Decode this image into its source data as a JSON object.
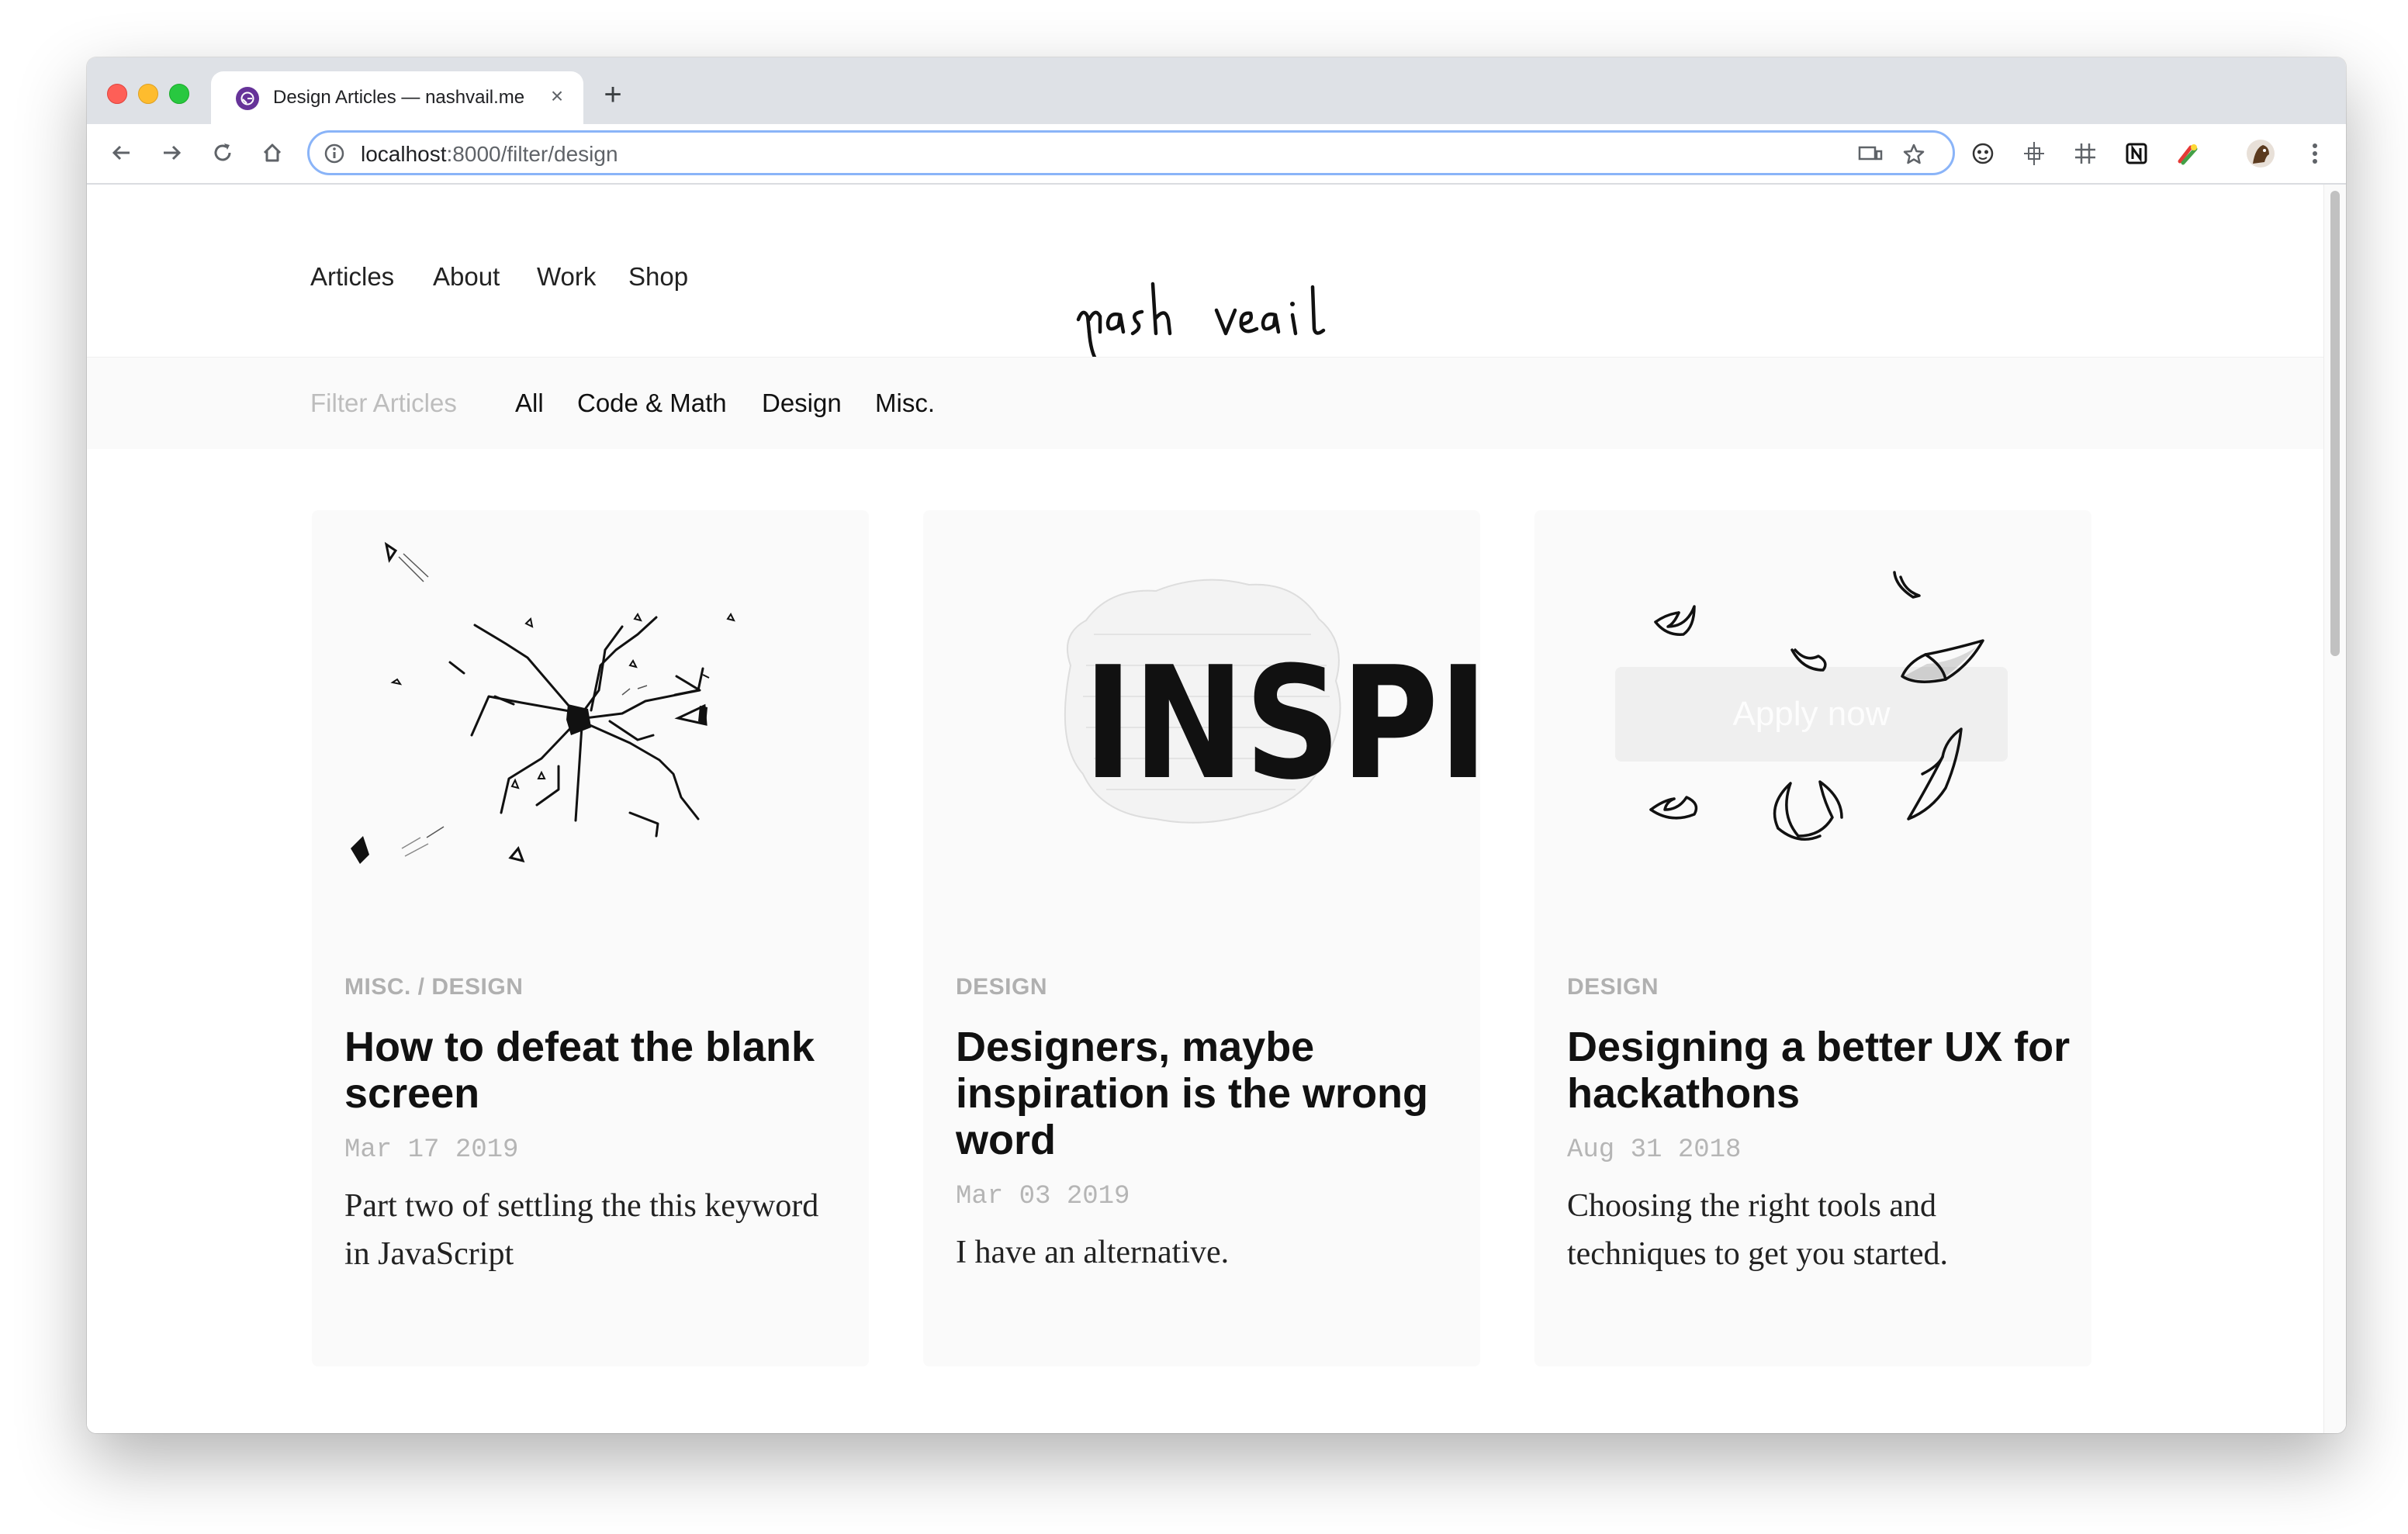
{
  "browser": {
    "tab_title": "Design Articles — nashvail.me",
    "tab_close": "×",
    "new_tab": "+",
    "url_host": "localhost",
    "url_rest": ":8000/filter/design"
  },
  "header": {
    "nav": [
      "Articles",
      "About",
      "Work",
      "Shop"
    ],
    "logo": "nash vail"
  },
  "filter": {
    "label": "Filter Articles",
    "options": [
      "All",
      "Code & Math",
      "Design",
      "Misc."
    ]
  },
  "cards": [
    {
      "category": "MISC. / DESIGN",
      "title": "How to defeat the blank screen",
      "date": "Mar 17 2019",
      "description": "Part two of settling the this keyword in JavaScript"
    },
    {
      "category": "DESIGN",
      "title": "Designers, maybe inspiration is the wrong word",
      "date": "Mar 03 2019",
      "description": "I have an alternative.",
      "image_text": "INSPI"
    },
    {
      "category": "DESIGN",
      "title": "Designing a better UX for hackathons",
      "date": "Aug 31 2018",
      "description": "Choosing the right tools and techniques to get you started.",
      "image_button": "Apply now"
    }
  ]
}
